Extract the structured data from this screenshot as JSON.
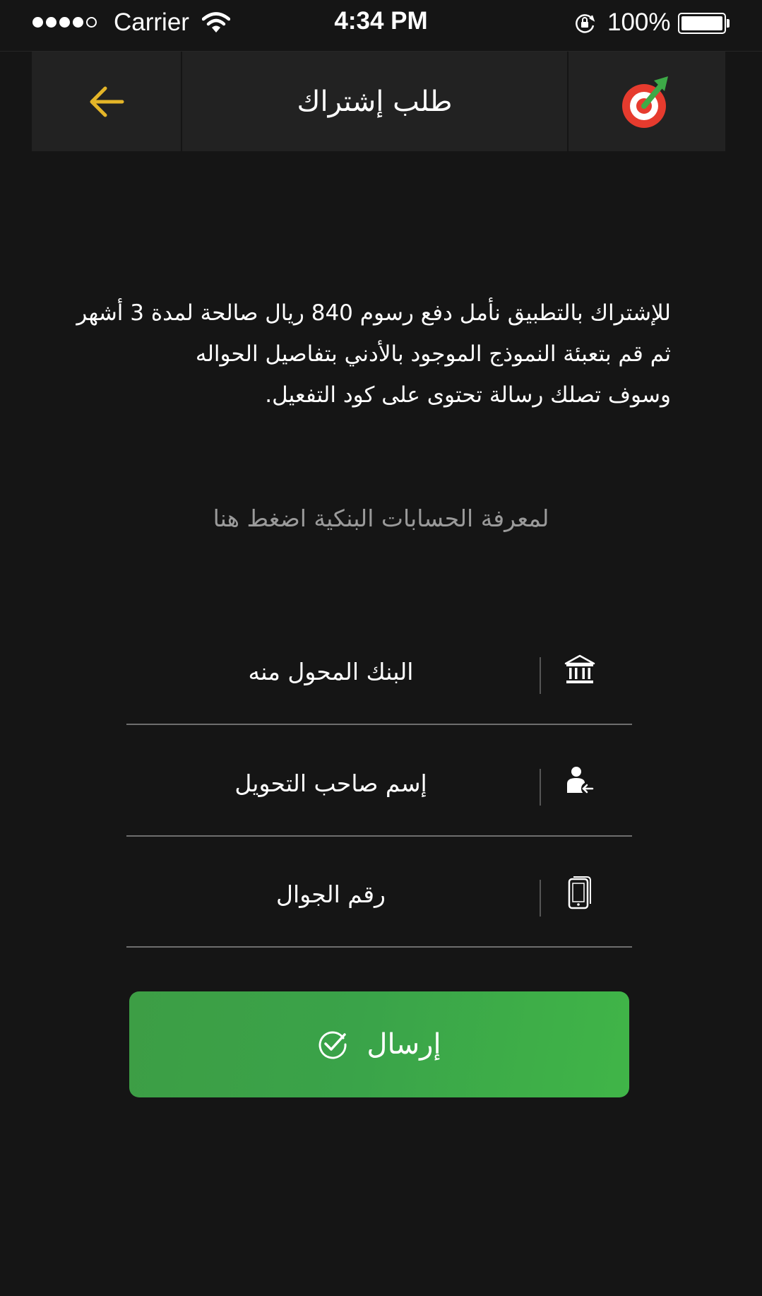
{
  "status_bar": {
    "carrier": "Carrier",
    "time": "4:34 PM",
    "battery": "100%"
  },
  "header": {
    "title": "طلب إشتراك",
    "back_icon": "arrow-left-icon",
    "logo_icon": "target-arrow-logo"
  },
  "intro": {
    "lines": [
      "للإشتراك بالتطبيق نأمل دفع رسوم 840 ريال صالحة لمدة 3 أشهر",
      "ثم قم بتعبئة النموذج الموجود بالأدني بتفاصيل الحواله",
      "وسوف  تصلك رسالة تحتوى على كود التفعيل."
    ]
  },
  "bank_accounts_link": "لمعرفة الحسابات البنكية اضغط هنا",
  "form": {
    "fields": [
      {
        "icon": "bank-icon",
        "placeholder": "البنك المحول منه",
        "value": ""
      },
      {
        "icon": "person-transfer-icon",
        "placeholder": "إسم صاحب التحويل",
        "value": ""
      },
      {
        "icon": "mobile-phone-icon",
        "placeholder": "رقم الجوال",
        "value": ""
      }
    ],
    "submit_label": "إرسال",
    "submit_icon": "check-circle-icon"
  },
  "colors": {
    "background": "#151515",
    "header_bg": "#222222",
    "accent_yellow": "#e4b528",
    "submit_green": "#3daa47",
    "logo_red": "#e63b2e",
    "logo_green": "#3daa47",
    "link_gray": "#9a9a9a"
  }
}
